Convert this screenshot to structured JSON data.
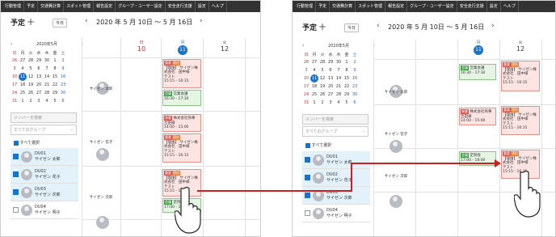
{
  "nav": [
    "行動管理",
    "予定",
    "交通費計算",
    "スポット管理",
    "報告設定",
    "グループ・ユーザー設定",
    "安全走行支援",
    "設定",
    "ヘルプ"
  ],
  "title": "予定",
  "plus": "+",
  "today": "今日",
  "prev": "‹",
  "next": "›",
  "range": "2020 年 5 月 10日 〜 5 月 16日",
  "calendar": {
    "month": "2020年5月",
    "weekdays": [
      "日",
      "月",
      "火",
      "水",
      "木",
      "金",
      "土"
    ],
    "weeks": [
      [
        "26",
        "27",
        "28",
        "29",
        "30",
        "1",
        "2"
      ],
      [
        "3",
        "4",
        "5",
        "6",
        "7",
        "8",
        "9"
      ],
      [
        "10",
        "11",
        "12",
        "13",
        "14",
        "15",
        "16"
      ],
      [
        "17",
        "18",
        "19",
        "20",
        "21",
        "22",
        "23"
      ],
      [
        "24",
        "25",
        "26",
        "27",
        "28",
        "29",
        "30"
      ],
      [
        "31",
        "1",
        "2",
        "3",
        "4",
        "5",
        "6"
      ]
    ],
    "selected": "11"
  },
  "search_placeholder": "メンバーを検索",
  "group_placeholder": "すべてのグループ",
  "select_all": "すべて選択",
  "members": [
    {
      "id": "DU01",
      "name": "サイゼン 太郎",
      "checked": true
    },
    {
      "id": "DU02",
      "name": "サイゼン 花子",
      "checked": true
    },
    {
      "id": "DU03",
      "name": "サイゼン 次郎",
      "checked": true
    },
    {
      "id": "DU04",
      "name": "サイゼン 明子",
      "checked": false
    }
  ],
  "days": [
    {
      "dow": "日",
      "num": "10"
    },
    {
      "dow": "月",
      "num": "11"
    },
    {
      "dow": "火",
      "num": "12"
    }
  ],
  "rows": [
    "サイゼン 太郎",
    "サイゼン 花子",
    "サイゼン 次郎"
  ],
  "events": {
    "e1": {
      "tags": [
        "重要",
        "理由"
      ],
      "text": "【理由】 サイゼン株式会社　田中様",
      "sub": "テスト",
      "time": "15:15 - 16:15"
    },
    "e2": {
      "tag": "会議",
      "text": "営業会議",
      "time": "16:30 - 17:30"
    },
    "e3": {
      "tag": "来客",
      "text": "株式会社商事　吉田様",
      "time": "14:00 - 15:00"
    },
    "e4": {
      "tags": [
        "重要",
        "理由"
      ],
      "text": "【理由】 サイゼン株式会社　田中様",
      "sub": "テスト",
      "time": "15:15 - 16:15"
    },
    "e5": {
      "tags": [
        "重要",
        "理由"
      ],
      "text": "【理由】 サイゼン株式会社　田中様",
      "sub": "テスト",
      "time": "15:15 - 16:15"
    },
    "e6": {
      "tag": "会議",
      "text": "定例会",
      "time": "17:00 - 18:00"
    }
  },
  "colors": {
    "accent": "#1a73c8",
    "arrow": "#cc1f1f",
    "nav": "#333333"
  }
}
